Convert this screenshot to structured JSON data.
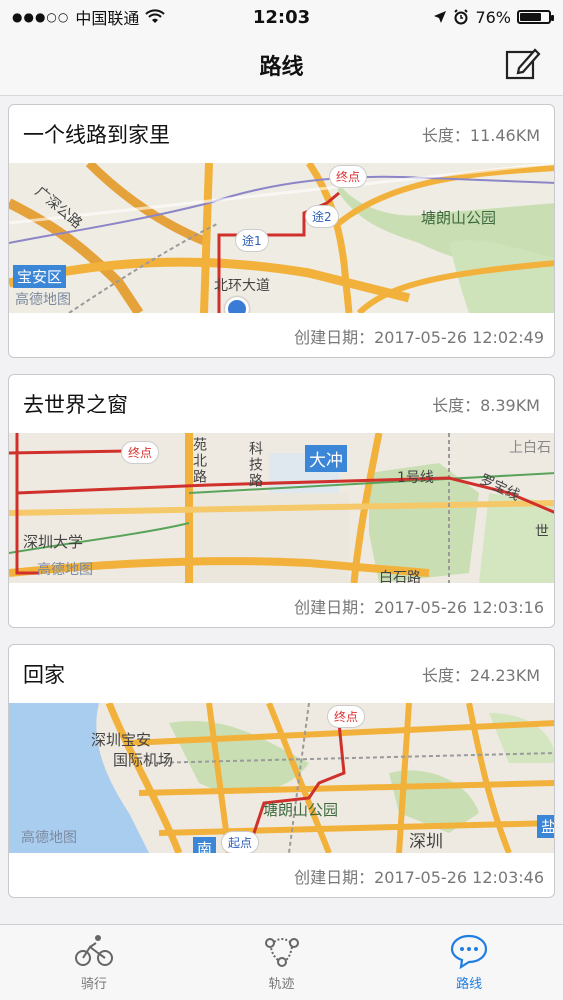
{
  "status_bar": {
    "carrier": "中国联通",
    "time": "12:03",
    "battery": "76%",
    "battery_level": 0.76
  },
  "nav": {
    "title": "路线",
    "compose_icon": "compose-icon"
  },
  "routes": [
    {
      "name": "一个线路到家里",
      "length": "长度：11.46KM",
      "created": "创建日期：2017-05-26 12:02:49",
      "map_labels": {
        "district": "宝安区",
        "park": "塘朗山公园",
        "road": "北环大道",
        "highway": "广深公路",
        "watermark": "高德地图",
        "end": "终点",
        "way1": "途1",
        "way2": "途2"
      }
    },
    {
      "name": "去世界之窗",
      "length": "长度：8.39KM",
      "created": "创建日期：2017-05-26 12:03:16",
      "map_labels": {
        "dachong": "大冲",
        "university": "深圳大学",
        "road1": "苑北路",
        "road2": "科技路",
        "line1": "1号线",
        "shibaixi": "上白石",
        "luobao": "罗宝线",
        "baishi": "白石路",
        "world": "世",
        "watermark": "高德地图",
        "end": "终点"
      }
    },
    {
      "name": "回家",
      "length": "长度：24.23KM",
      "created": "创建日期：2017-05-26 12:03:46",
      "map_labels": {
        "airport1": "深圳宝安",
        "airport2": "国际机场",
        "park": "塘朗山公园",
        "city": "深圳",
        "salt": "盐",
        "south": "南",
        "watermark": "高德地图",
        "end": "终点",
        "start": "起点"
      }
    }
  ],
  "tabs": [
    {
      "label": "骑行",
      "icon": "bicycle-icon"
    },
    {
      "label": "轨迹",
      "icon": "track-icon"
    },
    {
      "label": "路线",
      "icon": "route-chat-icon"
    }
  ],
  "colors": {
    "accent": "#1f7fe0",
    "route_line": "#d0302b",
    "road_orange": "#f2b13a"
  }
}
